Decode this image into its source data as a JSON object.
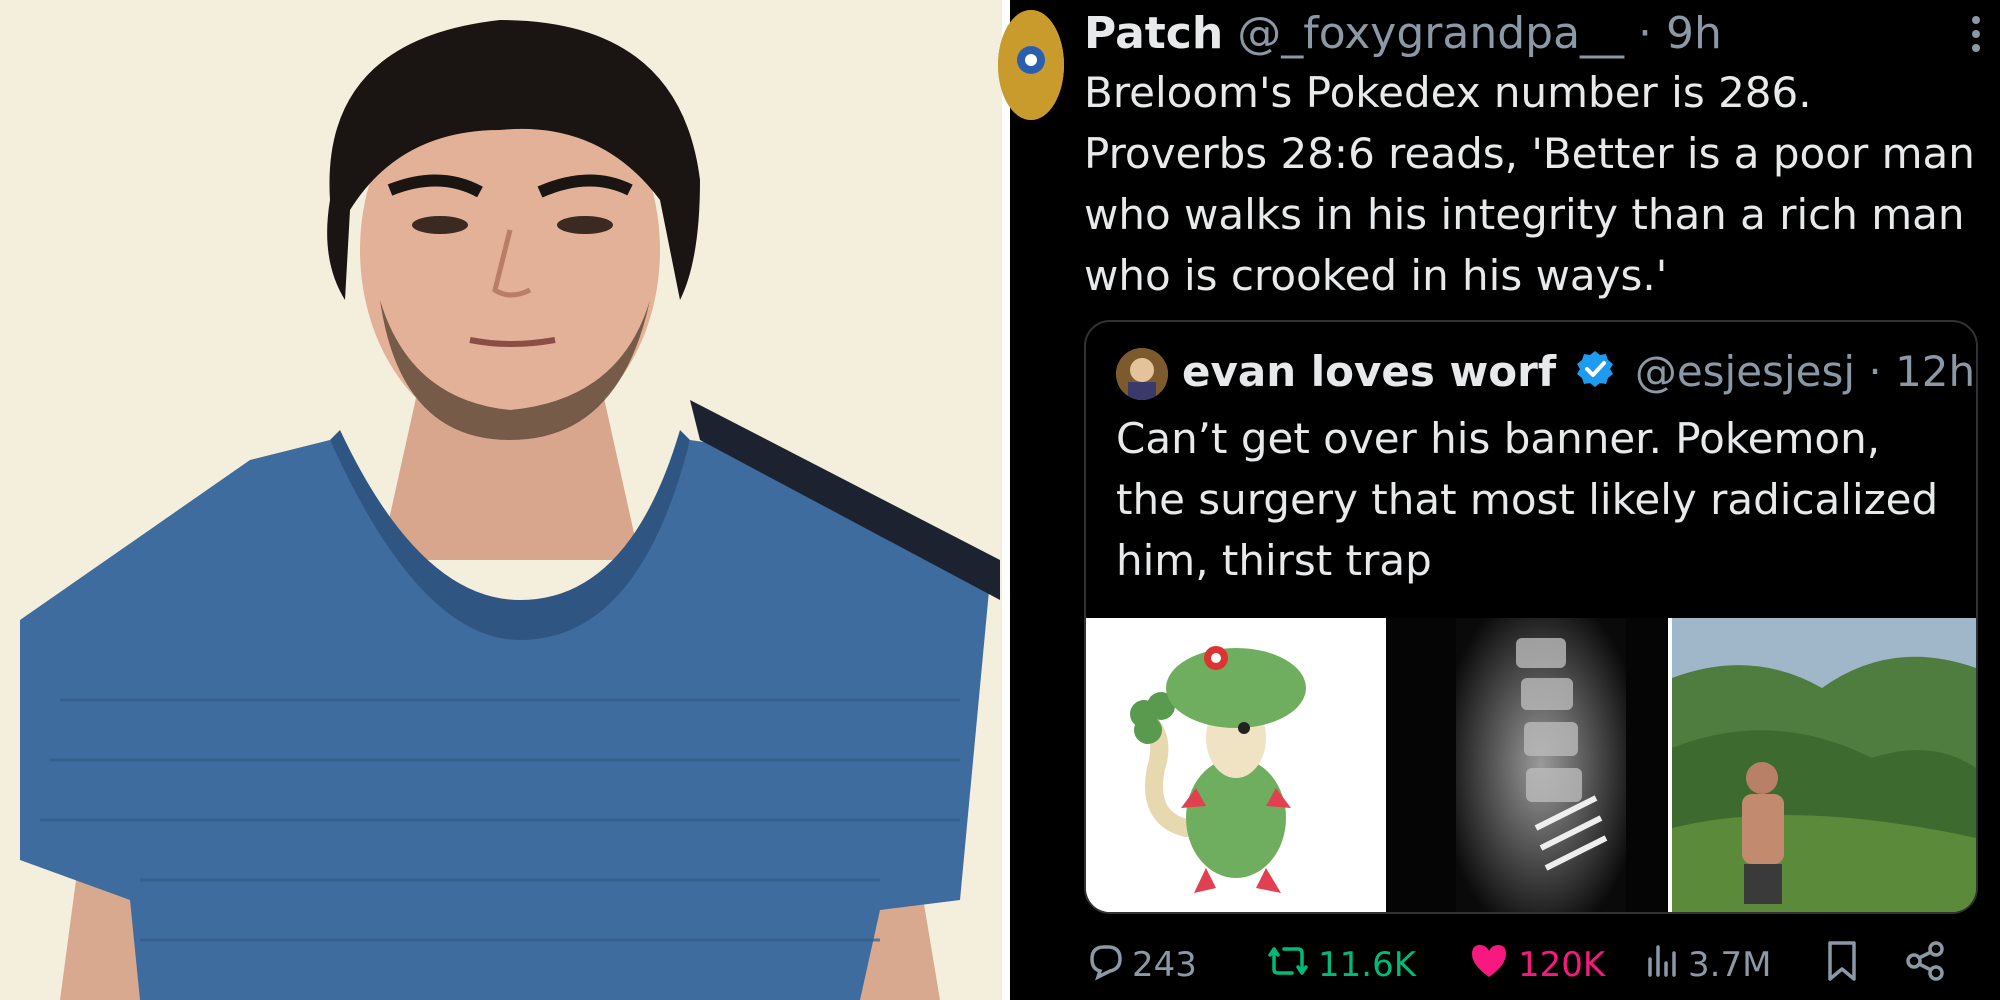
{
  "tweet": {
    "display_name": "Patch",
    "handle": "@_foxygrandpa__",
    "separator": " · ",
    "time": "9h",
    "text": "Breloom's Pokedex number is 286. Proverbs 28:6 reads, 'Better is a poor man who walks in his integrity than a rich man who is crooked in his ways.'"
  },
  "quote": {
    "display_name": "evan loves worf",
    "handle": "@esjesjesj",
    "separator": " · ",
    "time": "12h",
    "text": "Can’t get over his banner. Pokemon, the surgery that most likely radicalized him, thirst trap"
  },
  "metrics": {
    "replies": "243",
    "reposts": "11.6K",
    "likes": "120K",
    "views": "3.7M"
  },
  "icons": [
    "more-icon",
    "verified-icon",
    "reply-icon",
    "repost-icon",
    "like-icon",
    "views-icon",
    "bookmark-icon",
    "share-icon"
  ],
  "colors": {
    "background": "#000000",
    "text": "#e7e9ea",
    "muted": "#8b98a5",
    "repost": "#00ba7c",
    "like": "#f91880",
    "verified": "#1d9bf0"
  }
}
